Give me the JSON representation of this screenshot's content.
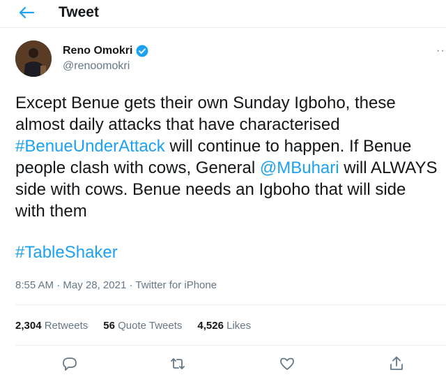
{
  "header": {
    "title": "Tweet"
  },
  "author": {
    "display_name": "Reno Omokri",
    "handle": "@renoomokri"
  },
  "tweet": {
    "line1": "Except Benue gets their own Sunday Igboho, these",
    "line2": "almost daily attacks that have characterised",
    "line3_hashtag": "#BenueUnderAttack",
    "line3_rest": " will continue to happen. If Benue",
    "line4_a": "people clash with cows, General ",
    "line4_mention": "@MBuhari",
    "line4_b": " will ALWAYS",
    "line5": "side with cows. Benue needs an Igboho that will side",
    "line6": "with them",
    "hashtag2": "#TableShaker"
  },
  "meta": {
    "time": "8:55 AM",
    "sep1": " · ",
    "date": "May 28, 2021",
    "sep2": " · ",
    "source": "Twitter for iPhone"
  },
  "stats": {
    "retweets_count": "2,304",
    "retweets_label": "Retweets",
    "quotes_count": "56",
    "quotes_label": "Quote Tweets",
    "likes_count": "4,526",
    "likes_label": "Likes"
  },
  "icons": {
    "back": "arrow-left",
    "verified": "verified-badge",
    "more": "more-horizontal",
    "reply": "reply",
    "retweet": "retweet",
    "like": "heart",
    "share": "share"
  },
  "colors": {
    "accent": "#1da1f2",
    "text": "#14171a",
    "secondary": "#657786",
    "border": "#e6ecf0"
  }
}
